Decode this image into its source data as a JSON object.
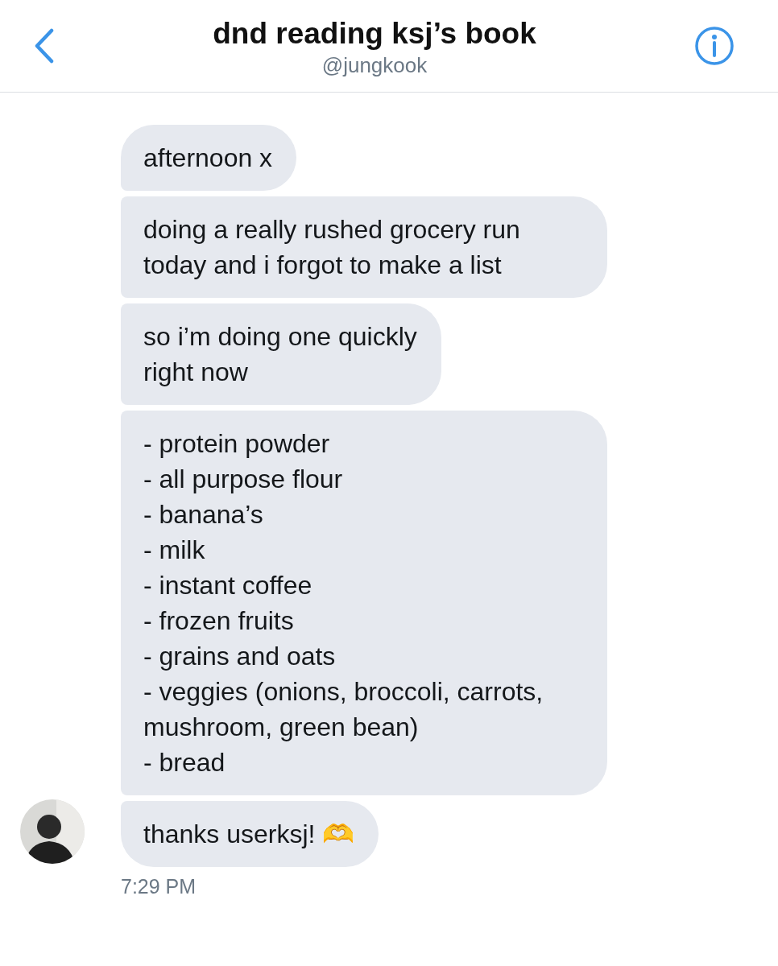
{
  "header": {
    "title": "dnd reading ksj’s book",
    "subtitle": "@jungkook"
  },
  "messages": [
    {
      "text": "afternoon x"
    },
    {
      "text": "doing a really rushed grocery run today and i forgot to make a list"
    },
    {
      "text": "so i’m doing one quickly\nright now"
    },
    {
      "text": "- protein powder\n- all purpose flour\n- banana’s\n- milk\n- instant coffee\n- frozen fruits\n- grains and oats\n- veggies (onions, broccoli, carrots, mushroom, green bean)\n- bread"
    },
    {
      "text": "thanks userksj! 🫶"
    }
  ],
  "timestamp": "7:29 PM"
}
